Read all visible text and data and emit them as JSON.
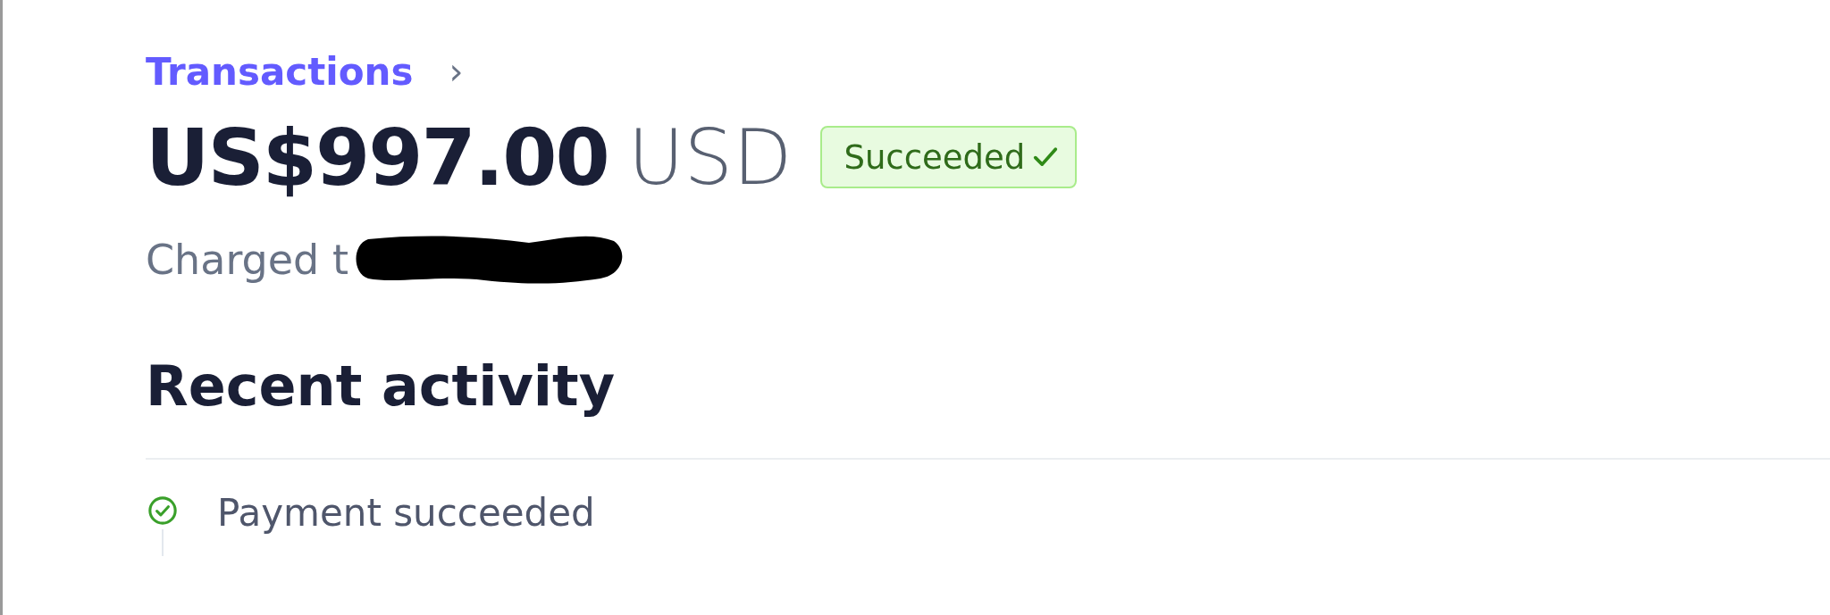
{
  "breadcrumb": {
    "label": "Transactions",
    "separator": "›"
  },
  "amount": {
    "value": "US$997.00",
    "currency": "USD"
  },
  "status": {
    "label": "Succeeded",
    "kind": "success"
  },
  "charged": {
    "text": "Charged t",
    "redacted": true
  },
  "recent_activity": {
    "title": "Recent activity",
    "items": [
      {
        "label": "Payment succeeded",
        "kind": "success"
      }
    ]
  }
}
